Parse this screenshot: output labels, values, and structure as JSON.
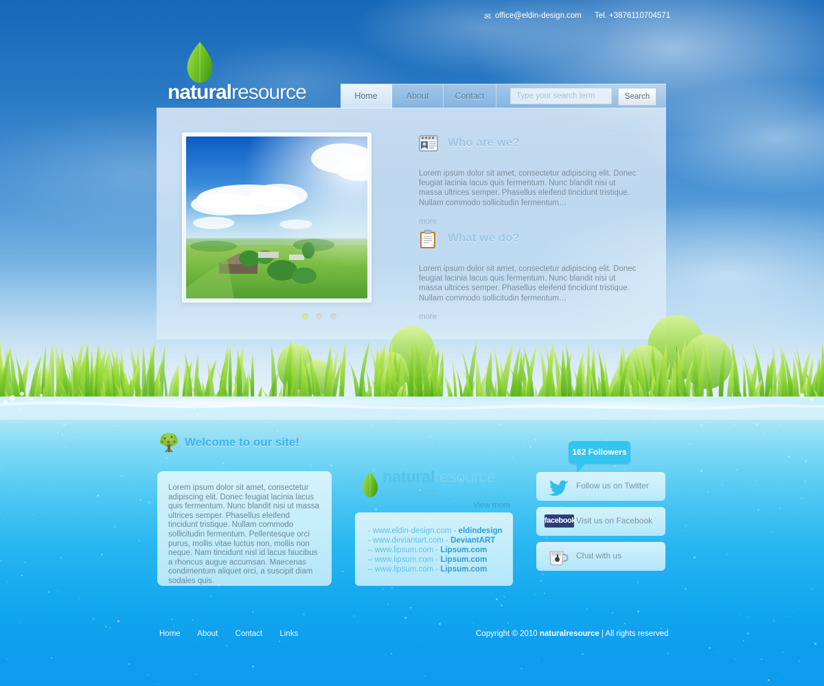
{
  "topbar": {
    "mail_icon": "envelope-icon",
    "email": "office@eldin-design.com",
    "phone": "Tel. +3876110704571"
  },
  "logo": {
    "icon": "leaf-icon",
    "name_bold": "natural",
    "name_light": "resource"
  },
  "nav": {
    "items": [
      {
        "label": "Home",
        "active": true
      },
      {
        "label": "About",
        "active": false
      },
      {
        "label": "Contact",
        "active": false
      }
    ],
    "search_value": "",
    "search_placeholder": "Type your search term",
    "search_button": "Search"
  },
  "slideshow": {
    "image_alt": "countryside-landscape-photo",
    "dots": [
      {
        "active": true
      },
      {
        "active": false
      },
      {
        "active": false
      }
    ]
  },
  "sections": [
    {
      "icon": "window-person-icon",
      "title": "Who are we?",
      "body": "Lorem ipsum dolor sit amet, consectetur adipiscing elit. Donec feugiat lacinia lacus quis fermentum. Nunc blandit nisi ut massa ultrices semper. Phasellus eleifend tincidunt tristique. Nullam commodo sollicitudin fermentum…",
      "more": "more"
    },
    {
      "icon": "clipboard-icon",
      "title": "What we do?",
      "body": "Lorem ipsum dolor sit amet, consectetur adipiscing elit. Donec feugiat lacinia lacus quis fermentum. Nunc blandit nisi ut massa ultrices semper. Phasellus eleifend tincidunt tristique. Nullam commodo sollicitudin fermentum…",
      "more": "more"
    }
  ],
  "welcome": {
    "icon": "tree-icon",
    "title": "Welcome to our site!",
    "body": "Lorem ipsum dolor sit amet, consectetur adipiscing elit. Donec feugiat lacinia lacus quis fermentum. Nunc blandit nisi ut massa ultrices semper. Phasellus eleifend tincidunt tristique. Nullam commodo sollicitudin fermentum. Pellentesque orci purus, mollis vitae luctus non, mollis non neque. Nam tincidunt nisl id lacus faucibus a rhoncus augue accumsan. Maecenas condimentum aliquet orci, a suscipit diam sodales quis."
  },
  "sponsored": {
    "icon": "leaf-icon",
    "brand_bold": "natural",
    "brand_light": "resource",
    "subtitle": "Sponsored links",
    "view_more": "View more",
    "links": [
      {
        "url": "- www.eldin-design.com -",
        "name": "eldindesign"
      },
      {
        "url": "- www.deviantart.com -",
        "name": "DeviantART"
      },
      {
        "url": "– www.lipsum.com -",
        "name": "Lipsum.com"
      },
      {
        "url": "– www.lipsum.com -",
        "name": "Lipsum.com"
      },
      {
        "url": "– www.lipsum.com -",
        "name": "Lipsum.com"
      }
    ]
  },
  "social": {
    "followers_badge": "162 Followers",
    "buttons": [
      {
        "icon": "twitter-bird-icon",
        "label": "Follow us on Twitter"
      },
      {
        "icon": "facebook-icon",
        "label": "Visit us on Facebook",
        "badge": "facebook"
      },
      {
        "icon": "coffee-cup-icon",
        "label": "Chat with us"
      }
    ]
  },
  "footer": {
    "links": [
      "Home",
      "About",
      "Contact",
      "Links"
    ],
    "copyright_pre": "Copyright © 2010 ",
    "copyright_brand": "naturalresource",
    "copyright_post": " | All rights reserved"
  },
  "colors": {
    "sky_top": "#1668b9",
    "sky_bottom": "#d6ebf6",
    "water_top": "#d2f1fa",
    "water_bottom": "#0f9aee",
    "accent_cyan": "#31c5f0",
    "heading_blue": "#9dc5e4",
    "welcome_blue": "#3fb2e6",
    "leaf_green": "#78c724",
    "facebook_navy": "#2c3e7a"
  }
}
